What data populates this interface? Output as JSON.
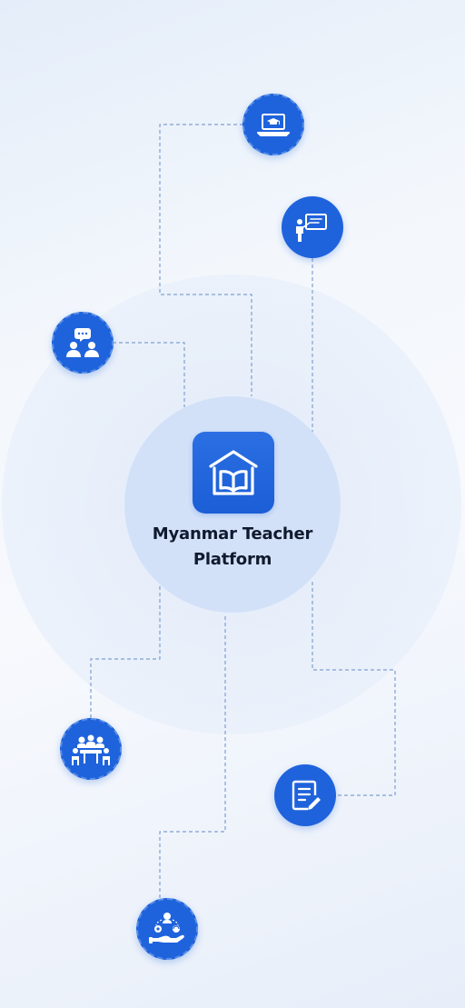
{
  "diagram": {
    "title_line1": "Myanmar Teacher",
    "title_line2": "Platform"
  },
  "nodes": [
    {
      "name": "online-learning",
      "icon": "laptop-graduation-cap-icon"
    },
    {
      "name": "teacher-presentation",
      "icon": "teacher-whiteboard-icon"
    },
    {
      "name": "community-discussion",
      "icon": "people-chat-icon"
    },
    {
      "name": "group-meeting",
      "icon": "meeting-table-icon"
    },
    {
      "name": "assessment",
      "icon": "document-edit-icon"
    },
    {
      "name": "support-services",
      "icon": "hand-services-icon"
    }
  ],
  "colors": {
    "accent": "#1f63dc",
    "hub": "#d3e1f8",
    "connector": "#7f9fd0",
    "title": "#0f1a2e"
  }
}
